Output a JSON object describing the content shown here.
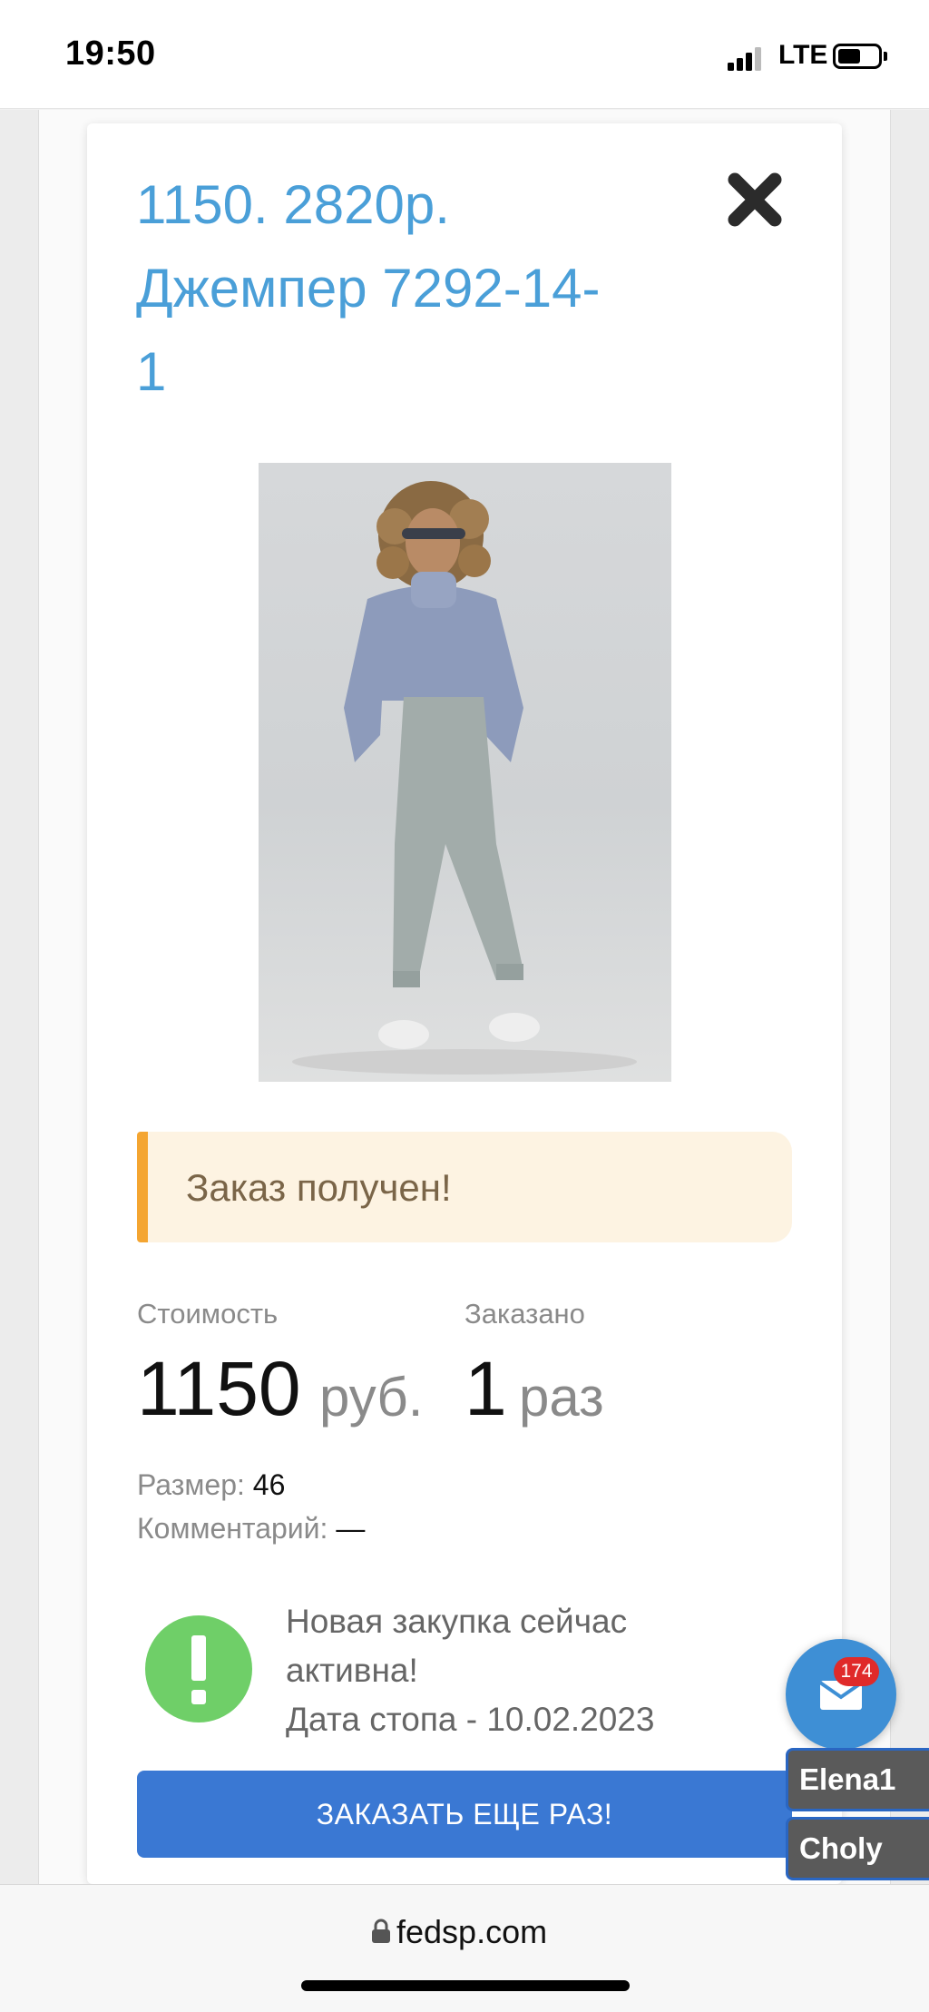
{
  "status_bar": {
    "time": "19:50",
    "network": "LTE"
  },
  "modal": {
    "title_lines": [
      "1150. 2820р.",
      "Джемпер 7292-14-",
      "1"
    ],
    "alert": "Заказ получен!",
    "price": {
      "label": "Стоимость",
      "value": "1150",
      "unit": "руб."
    },
    "ordered": {
      "label": "Заказано",
      "value": "1",
      "unit": "раз"
    },
    "size": {
      "label": "Размер:",
      "value": "46"
    },
    "comment": {
      "label": "Комментарий:",
      "value": "—"
    },
    "notice": {
      "line1": "Новая закупка сейчас",
      "line2": "активна!",
      "line3": "Дата стопа - 10.02.2023"
    },
    "order_button": "ЗАКАЗАТЬ ЕЩЕ РАЗ!"
  },
  "chat": {
    "badge": "174",
    "users": [
      "Elena1",
      "Choly"
    ]
  },
  "browser": {
    "url": "fedsp.com"
  },
  "colors": {
    "title": "#4a9fd8",
    "button": "#3a78d3",
    "alert_border": "#f4a531",
    "notice_icon": "#6fcf68",
    "badge": "#e02a2a"
  }
}
